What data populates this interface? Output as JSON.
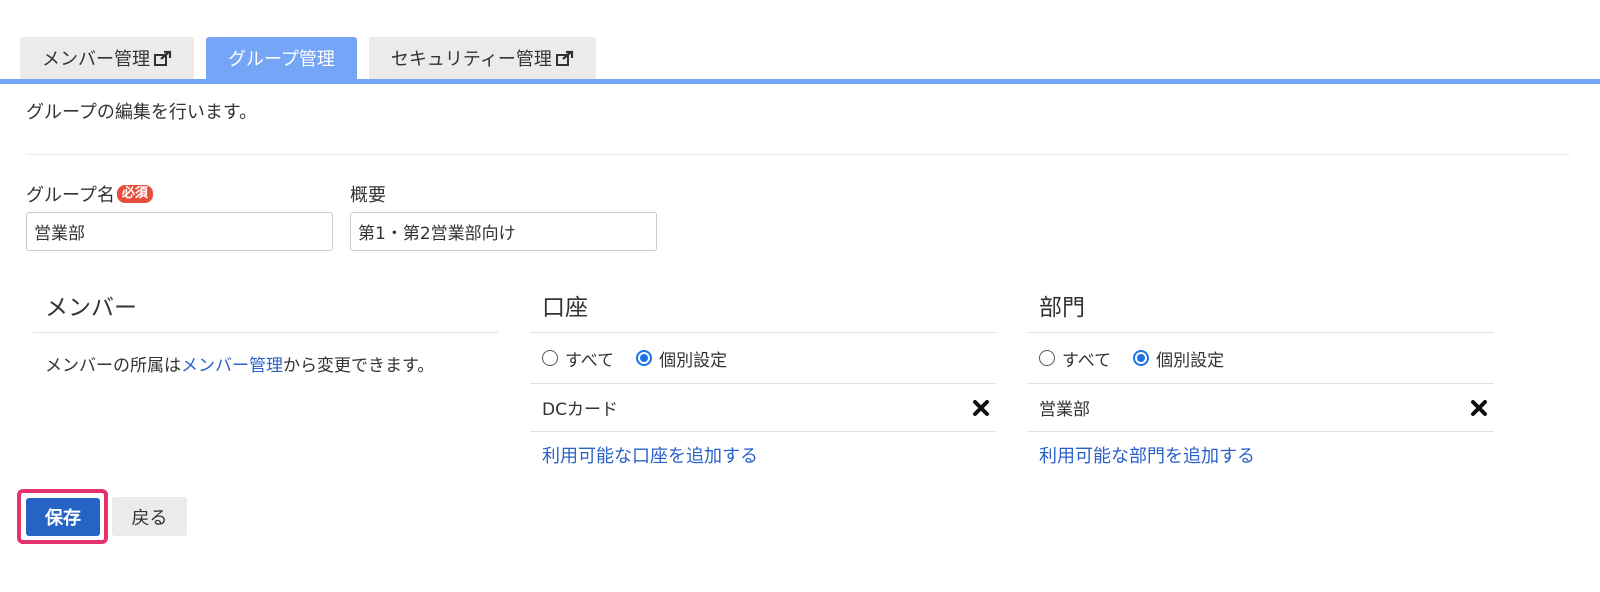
{
  "tabs": [
    {
      "label": "メンバー管理",
      "external": true,
      "active": false
    },
    {
      "label": "グループ管理",
      "external": false,
      "active": true
    },
    {
      "label": "セキュリティー管理",
      "external": true,
      "active": false
    }
  ],
  "description": "グループの編集を行います。",
  "form": {
    "group_name_label": "グループ名",
    "required_badge": "必須",
    "group_name_value": "営業部",
    "summary_label": "概要",
    "summary_value": "第1・第2営業部向け"
  },
  "member_section": {
    "title": "メンバー",
    "note_prefix": "メンバーの所属は",
    "note_link": "メンバー管理",
    "note_suffix": "から変更できます。"
  },
  "account_section": {
    "title": "口座",
    "radio_all": "すべて",
    "radio_individual": "個別設定",
    "selected": "個別設定",
    "items": [
      "DCカード"
    ],
    "add_link": "利用可能な口座を追加する"
  },
  "department_section": {
    "title": "部門",
    "radio_all": "すべて",
    "radio_individual": "個別設定",
    "selected": "個別設定",
    "items": [
      "営業部"
    ],
    "add_link": "利用可能な部門を追加する"
  },
  "buttons": {
    "save": "保存",
    "back": "戻る"
  },
  "colors": {
    "accent": "#75a5f6",
    "primary_button": "#2563c4",
    "highlight": "#e5326a",
    "required": "#e74c3c",
    "link": "#2a62c9"
  }
}
